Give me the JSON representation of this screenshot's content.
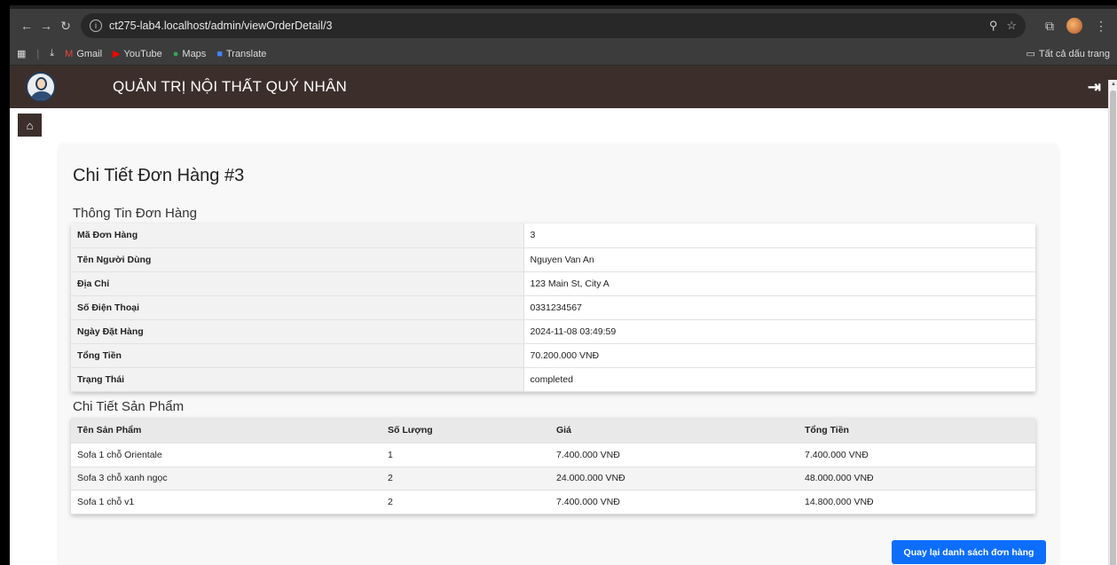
{
  "browser": {
    "url": "ct275-lab4.localhost/admin/viewOrderDetail/3",
    "bookmarks": [
      {
        "label": "Gmail",
        "icon": "gmail-icon"
      },
      {
        "label": "YouTube",
        "icon": "youtube-icon"
      },
      {
        "label": "Maps",
        "icon": "maps-icon"
      },
      {
        "label": "Translate",
        "icon": "translate-icon"
      }
    ],
    "all_bookmarks": "Tất cả dấu trang"
  },
  "app": {
    "title": "QUẢN TRỊ NỘI THẤT QUÝ NHÂN",
    "header_bg": "#3c2f2b"
  },
  "page": {
    "heading": "Chi Tiết Đơn Hàng #3",
    "order_info_title": "Thông Tin Đơn Hàng",
    "order_info": [
      {
        "label": "Mã Đơn Hàng",
        "value": "3"
      },
      {
        "label": "Tên Người Dùng",
        "value": "Nguyen Van An"
      },
      {
        "label": "Địa Chỉ",
        "value": "123 Main St, City A"
      },
      {
        "label": "Số Điện Thoại",
        "value": "0331234567"
      },
      {
        "label": "Ngày Đặt Hàng",
        "value": "2024-11-08 03:49:59"
      },
      {
        "label": "Tổng Tiền",
        "value": "70.200.000 VNĐ"
      },
      {
        "label": "Trạng Thái",
        "value": "completed"
      }
    ],
    "products_title": "Chi Tiết Sản Phẩm",
    "product_columns": [
      "Tên Sản Phẩm",
      "Số Lượng",
      "Giá",
      "Tổng Tiền"
    ],
    "products": [
      [
        "Sofa 1 chỗ Orientale",
        "1",
        "7.400.000 VNĐ",
        "7.400.000 VNĐ"
      ],
      [
        "Sofa 3 chỗ xanh ngọc",
        "2",
        "24.000.000 VNĐ",
        "48.000.000 VNĐ"
      ],
      [
        "Sofa 1 chỗ v1",
        "2",
        "7.400.000 VNĐ",
        "14.800.000 VNĐ"
      ]
    ],
    "back_button": "Quay lại danh sách đơn hàng",
    "accent": "#0d6efd"
  }
}
